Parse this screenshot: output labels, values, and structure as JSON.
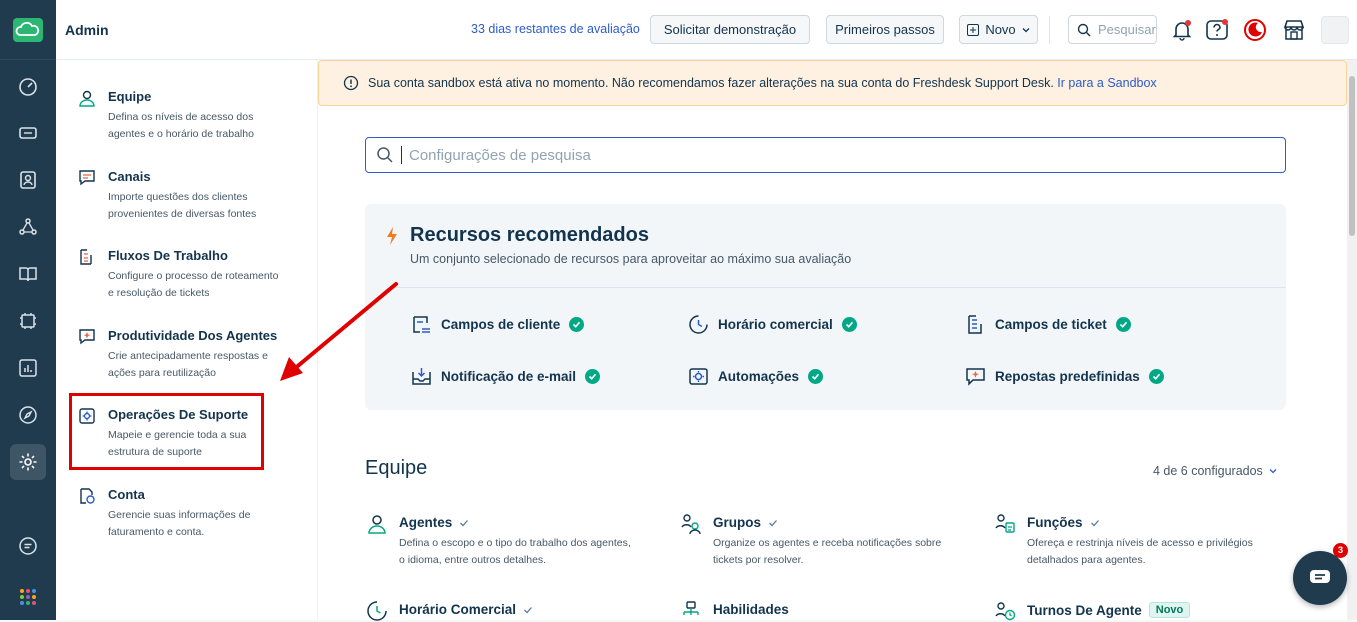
{
  "header": {
    "title": "Admin",
    "trial_text": "33 dias restantes de avaliação",
    "demo_label": "Solicitar demonstração",
    "first_steps_label": "Primeiros passos",
    "new_label": "Novo",
    "search_placeholder": "Pesquisar"
  },
  "settings": {
    "items": [
      {
        "title": "Equipe",
        "desc": "Defina os níveis de acesso dos agentes e o horário de trabalho",
        "icon": "user-icon"
      },
      {
        "title": "Canais",
        "desc": "Importe questões dos clientes provenientes de diversas fontes",
        "icon": "chat-icon"
      },
      {
        "title": "Fluxos De Trabalho",
        "desc": "Configure o processo de roteamento e resolução de tickets",
        "icon": "workflow-icon"
      },
      {
        "title": "Produtividade Dos Agentes",
        "desc": "Crie antecipadamente respostas e ações para reutilização",
        "icon": "canned-response-icon"
      },
      {
        "title": "Operações De Suporte",
        "desc": "Mapeie e gerencie toda a sua estrutura de suporte",
        "icon": "support-ops-icon"
      },
      {
        "title": "Conta",
        "desc": "Gerencie suas informações de faturamento e conta.",
        "icon": "account-icon"
      }
    ]
  },
  "banner": {
    "text": "Sua conta sandbox está ativa no momento. Não recomendamos fazer alterações na sua conta do Freshdesk Support Desk.",
    "link": "Ir para a Sandbox"
  },
  "search": {
    "placeholder": "Configurações de pesquisa"
  },
  "recommended": {
    "title": "Recursos recomendados",
    "subtitle": "Um conjunto selecionado de recursos para aproveitar ao máximo sua avaliação",
    "features": [
      {
        "label": "Campos de cliente",
        "icon": "customer-fields-icon"
      },
      {
        "label": "Horário comercial",
        "icon": "business-hours-icon"
      },
      {
        "label": "Campos de ticket",
        "icon": "ticket-fields-icon"
      },
      {
        "label": "Notificação de e-mail",
        "icon": "email-notification-icon"
      },
      {
        "label": "Automações",
        "icon": "automation-icon"
      },
      {
        "label": "Repostas predefinidas",
        "icon": "canned-response-icon"
      }
    ]
  },
  "team": {
    "title": "Equipe",
    "count": "4 de 6 configurados",
    "cards": [
      {
        "title": "Agentes",
        "desc": "Defina o escopo e o tipo do trabalho dos agentes, o idioma, entre outros detalhes."
      },
      {
        "title": "Grupos",
        "desc": "Organize os agentes e receba notificações sobre tickets por resolver."
      },
      {
        "title": "Funções",
        "desc": "Ofereça e restrinja níveis de acesso e privilégios detalhados para agentes."
      },
      {
        "title": "Horário Comercial",
        "desc": ""
      },
      {
        "title": "Habilidades",
        "desc": ""
      },
      {
        "title": "Turnos De Agente",
        "desc": "",
        "badge": "Novo"
      }
    ]
  },
  "chat": {
    "badge": "3"
  },
  "colors": {
    "rail": "#1f3b4d",
    "accent": "#2c5cc5",
    "success": "#00a886",
    "highlight": "#e00000"
  }
}
